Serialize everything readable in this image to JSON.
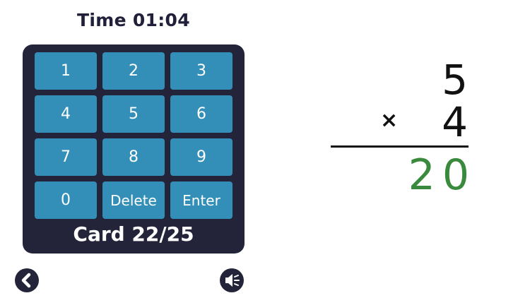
{
  "timer": {
    "text": "Time 01:04"
  },
  "keypad": {
    "keys": [
      "1",
      "2",
      "3",
      "4",
      "5",
      "6",
      "7",
      "8",
      "9",
      "0",
      "Delete",
      "Enter"
    ]
  },
  "card_counter": {
    "text": "Card 22/25"
  },
  "nav": {
    "back_icon": "chevron-left-icon",
    "sound_icon": "speaker-icon"
  },
  "problem": {
    "top_number": "5",
    "operator": "×",
    "bottom_number": "4",
    "answer": "20"
  },
  "colors": {
    "panel": "#232439",
    "key": "#338fb7",
    "answer": "#3a8a3e"
  }
}
